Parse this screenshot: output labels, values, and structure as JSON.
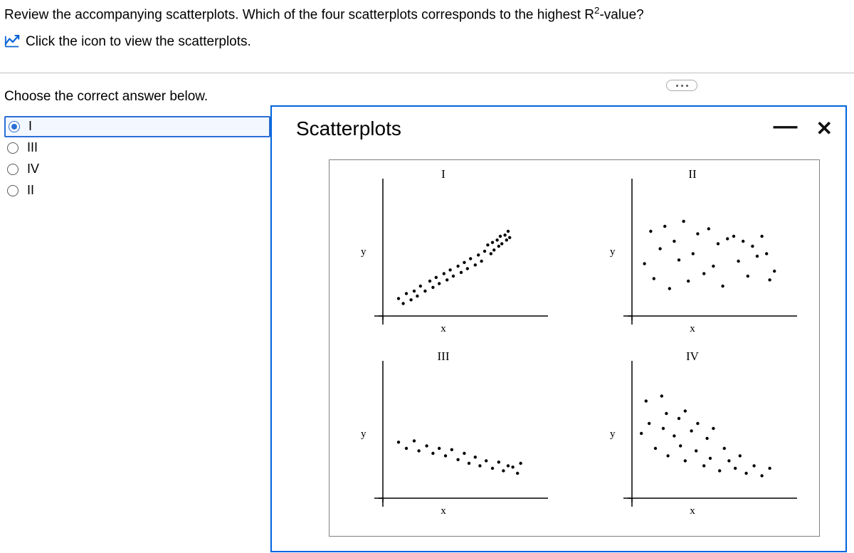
{
  "question": {
    "text_before_sup": "Review the accompanying scatterplots. Which of the four scatterplots corresponds to the highest R",
    "sup": "2",
    "text_after_sup": "-value?"
  },
  "link_hint": "Click the icon to view the scatterplots.",
  "prompt_choose": "Choose the correct answer below.",
  "options": [
    {
      "label": "I",
      "selected": true
    },
    {
      "label": "III",
      "selected": false
    },
    {
      "label": "IV",
      "selected": false
    },
    {
      "label": "II",
      "selected": false
    }
  ],
  "popup": {
    "title": "Scatterplots",
    "minimize": "—",
    "close": "✕",
    "plots": [
      {
        "title": "I",
        "xlabel": "x",
        "ylabel": "y"
      },
      {
        "title": "II",
        "xlabel": "x",
        "ylabel": "y"
      },
      {
        "title": "III",
        "xlabel": "x",
        "ylabel": "y"
      },
      {
        "title": "IV",
        "xlabel": "x",
        "ylabel": "y"
      }
    ]
  },
  "chart_data": [
    {
      "type": "scatter",
      "title": "I",
      "xlabel": "x",
      "ylabel": "y",
      "xlim": [
        0,
        10
      ],
      "ylim": [
        0,
        10
      ],
      "points": [
        [
          1.0,
          1.4
        ],
        [
          1.3,
          1.0
        ],
        [
          1.5,
          1.8
        ],
        [
          1.8,
          1.3
        ],
        [
          2.0,
          2.0
        ],
        [
          2.2,
          1.6
        ],
        [
          2.4,
          2.4
        ],
        [
          2.7,
          2.0
        ],
        [
          3.0,
          2.8
        ],
        [
          3.2,
          2.3
        ],
        [
          3.4,
          3.1
        ],
        [
          3.6,
          2.6
        ],
        [
          3.9,
          3.4
        ],
        [
          4.1,
          2.9
        ],
        [
          4.3,
          3.7
        ],
        [
          4.5,
          3.2
        ],
        [
          4.8,
          4.0
        ],
        [
          5.0,
          3.5
        ],
        [
          5.2,
          4.3
        ],
        [
          5.4,
          3.8
        ],
        [
          5.6,
          4.6
        ],
        [
          5.9,
          4.1
        ],
        [
          6.1,
          4.9
        ],
        [
          6.3,
          4.4
        ],
        [
          6.5,
          5.2
        ],
        [
          6.7,
          5.7
        ],
        [
          6.9,
          5.0
        ],
        [
          7.0,
          5.9
        ],
        [
          7.1,
          5.3
        ],
        [
          7.3,
          6.1
        ],
        [
          7.4,
          5.6
        ],
        [
          7.5,
          6.4
        ],
        [
          7.6,
          5.8
        ],
        [
          7.8,
          6.5
        ],
        [
          7.9,
          6.1
        ],
        [
          8.0,
          6.8
        ],
        [
          8.1,
          6.3
        ]
      ]
    },
    {
      "type": "scatter",
      "title": "II",
      "xlabel": "x",
      "ylabel": "y",
      "xlim": [
        0,
        10
      ],
      "ylim": [
        0,
        10
      ],
      "points": [
        [
          0.8,
          4.2
        ],
        [
          1.2,
          6.8
        ],
        [
          1.4,
          3.0
        ],
        [
          1.8,
          5.4
        ],
        [
          2.1,
          7.2
        ],
        [
          2.4,
          2.2
        ],
        [
          2.7,
          6.0
        ],
        [
          3.0,
          4.5
        ],
        [
          3.3,
          7.6
        ],
        [
          3.6,
          2.8
        ],
        [
          3.9,
          5.0
        ],
        [
          4.2,
          6.6
        ],
        [
          4.6,
          3.4
        ],
        [
          4.9,
          7.0
        ],
        [
          5.2,
          4.0
        ],
        [
          5.5,
          5.8
        ],
        [
          5.8,
          2.4
        ],
        [
          6.1,
          6.2
        ],
        [
          6.5,
          6.4
        ],
        [
          6.8,
          4.4
        ],
        [
          7.1,
          6.0
        ],
        [
          7.4,
          3.2
        ],
        [
          7.7,
          5.6
        ],
        [
          8.0,
          4.8
        ],
        [
          8.3,
          6.4
        ],
        [
          8.6,
          5.0
        ],
        [
          8.8,
          2.9
        ],
        [
          9.1,
          3.6
        ]
      ]
    },
    {
      "type": "scatter",
      "title": "III",
      "xlabel": "x",
      "ylabel": "y",
      "xlim": [
        0,
        10
      ],
      "ylim": [
        0,
        10
      ],
      "points": [
        [
          1.0,
          4.5
        ],
        [
          1.5,
          4.0
        ],
        [
          2.0,
          4.6
        ],
        [
          2.3,
          3.8
        ],
        [
          2.8,
          4.2
        ],
        [
          3.2,
          3.6
        ],
        [
          3.6,
          4.0
        ],
        [
          4.0,
          3.4
        ],
        [
          4.4,
          3.9
        ],
        [
          4.8,
          3.1
        ],
        [
          5.2,
          3.6
        ],
        [
          5.5,
          2.8
        ],
        [
          5.9,
          3.3
        ],
        [
          6.2,
          2.6
        ],
        [
          6.6,
          3.0
        ],
        [
          7.0,
          2.4
        ],
        [
          7.4,
          2.9
        ],
        [
          7.7,
          2.2
        ],
        [
          8.0,
          2.6
        ],
        [
          8.3,
          2.5
        ],
        [
          8.6,
          2.0
        ],
        [
          8.8,
          2.8
        ]
      ]
    },
    {
      "type": "scatter",
      "title": "IV",
      "xlabel": "x",
      "ylabel": "y",
      "xlim": [
        0,
        10
      ],
      "ylim": [
        0,
        10
      ],
      "points": [
        [
          0.6,
          5.2
        ],
        [
          0.9,
          7.8
        ],
        [
          1.1,
          6.0
        ],
        [
          1.5,
          4.0
        ],
        [
          1.9,
          8.2
        ],
        [
          2.0,
          5.6
        ],
        [
          2.2,
          6.8
        ],
        [
          2.3,
          3.4
        ],
        [
          2.7,
          5.0
        ],
        [
          3.0,
          6.4
        ],
        [
          3.1,
          4.2
        ],
        [
          3.4,
          7.0
        ],
        [
          3.4,
          3.0
        ],
        [
          3.8,
          5.4
        ],
        [
          4.1,
          3.8
        ],
        [
          4.2,
          6.0
        ],
        [
          4.6,
          2.6
        ],
        [
          4.8,
          4.8
        ],
        [
          5.0,
          3.2
        ],
        [
          5.2,
          5.6
        ],
        [
          5.6,
          2.2
        ],
        [
          5.9,
          4.0
        ],
        [
          6.2,
          3.0
        ],
        [
          6.6,
          2.4
        ],
        [
          6.9,
          3.4
        ],
        [
          7.3,
          2.0
        ],
        [
          7.8,
          2.6
        ],
        [
          8.3,
          1.8
        ],
        [
          8.8,
          2.4
        ]
      ]
    }
  ]
}
